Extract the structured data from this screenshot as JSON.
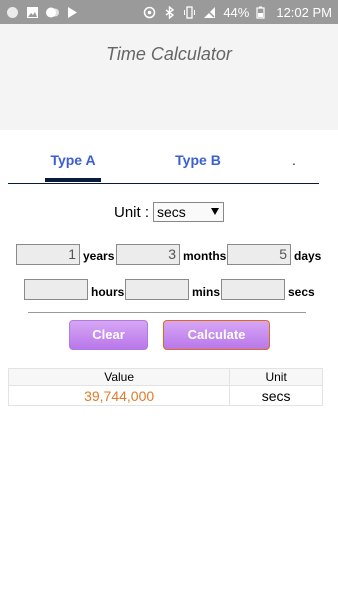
{
  "status_bar": {
    "battery": "44%",
    "time": "12:02 PM"
  },
  "app": {
    "title": "Time Calculator"
  },
  "tabs": [
    {
      "label": "Type A",
      "selected": true
    },
    {
      "label": "Type B",
      "selected": false
    },
    {
      "label": ".",
      "selected": false
    }
  ],
  "unit": {
    "label": "Unit :",
    "selected": "secs"
  },
  "inputs": {
    "years": {
      "value": "1",
      "label": "years"
    },
    "months": {
      "value": "3",
      "label": "months"
    },
    "days": {
      "value": "5",
      "label": "days"
    },
    "hours": {
      "value": "",
      "label": "hours"
    },
    "mins": {
      "value": "",
      "label": "mins"
    },
    "secs": {
      "value": "",
      "label": "secs"
    }
  },
  "buttons": {
    "clear": "Clear",
    "calculate": "Calculate"
  },
  "result": {
    "headers": [
      "Value",
      "Unit"
    ],
    "value": "39,744,000",
    "unit": "secs"
  },
  "colors": {
    "tab_text": "#3b5fd0",
    "button": "#c88cf0",
    "result_value": "#e07a2a"
  }
}
